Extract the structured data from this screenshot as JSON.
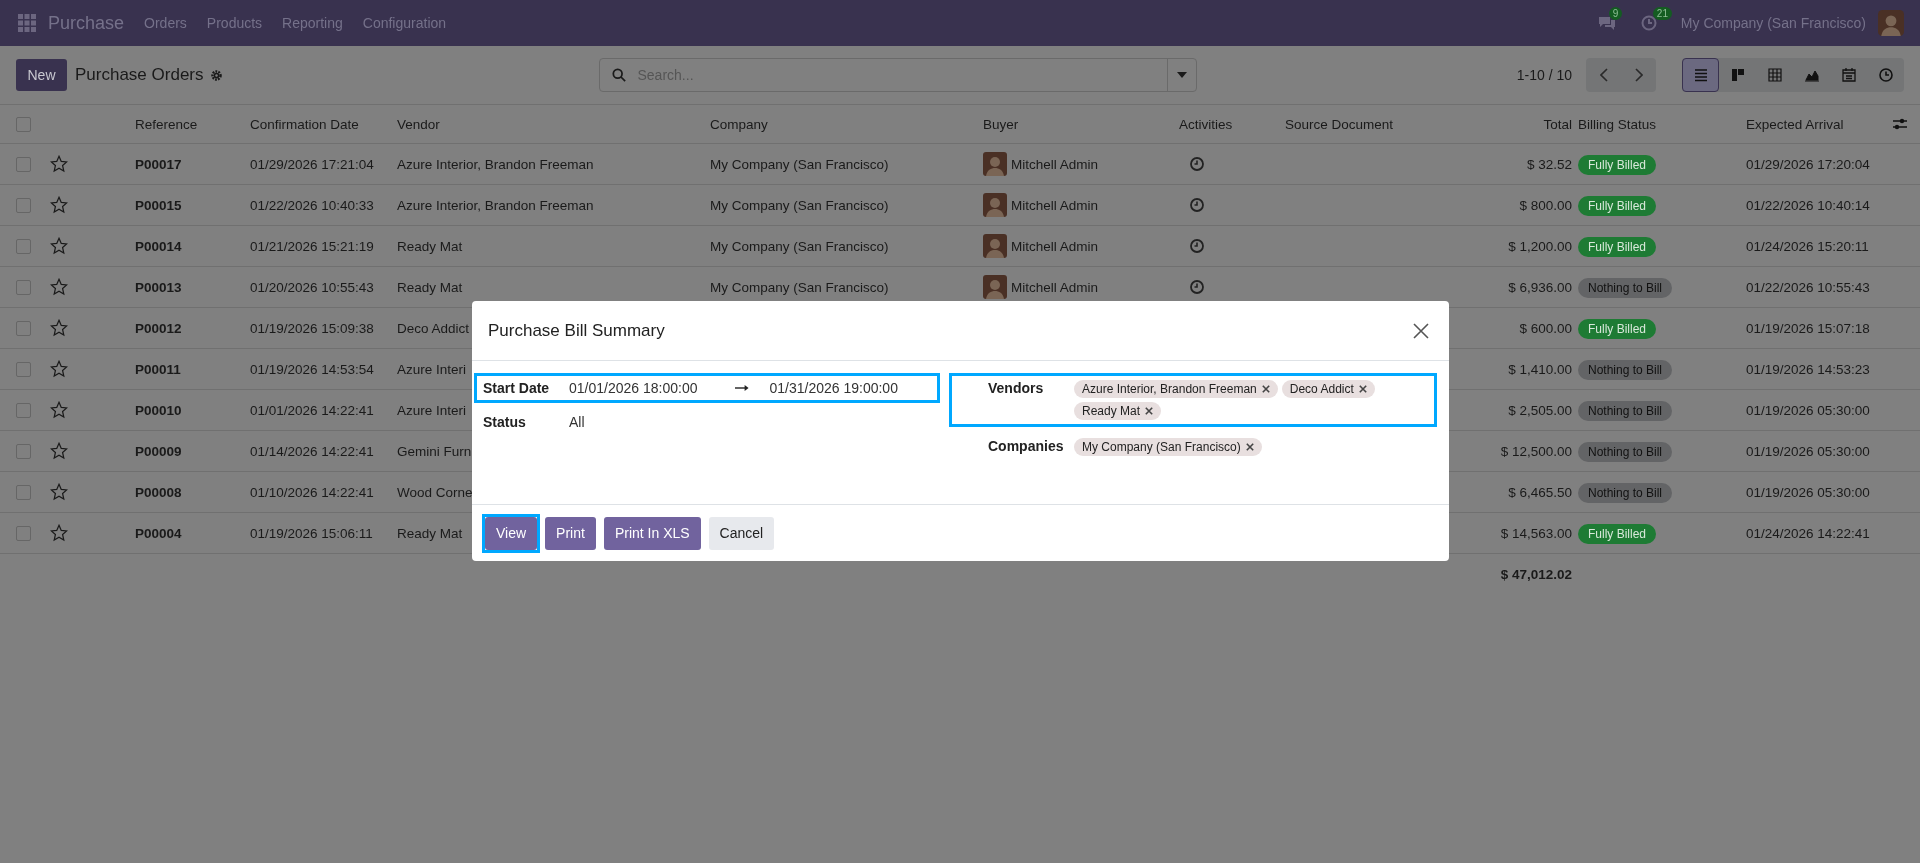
{
  "navbar": {
    "app_name": "Purchase",
    "menu": [
      "Orders",
      "Products",
      "Reporting",
      "Configuration"
    ],
    "messages_count": "9",
    "activities_count": "21",
    "company": "My Company (San Francisco)"
  },
  "control_panel": {
    "new_button": "New",
    "title": "Purchase Orders",
    "search": {
      "placeholder": "Search..."
    },
    "pager": "1-10 / 10",
    "views": [
      {
        "kind": "list",
        "selected": true
      },
      {
        "kind": "kanban",
        "selected": false
      },
      {
        "kind": "pivot",
        "selected": false
      },
      {
        "kind": "graph",
        "selected": false
      },
      {
        "kind": "calendar",
        "selected": false
      },
      {
        "kind": "activity",
        "selected": false
      }
    ]
  },
  "table": {
    "all_selected": false,
    "columns": [
      "Reference",
      "Confirmation Date",
      "Vendor",
      "Company",
      "Buyer",
      "Activities",
      "Source Document",
      "Total",
      "Billing Status",
      "Expected Arrival"
    ],
    "rows": [
      {
        "selected": false,
        "starred": false,
        "reference": "P00017",
        "confirmation_date": "01/29/2026 17:21:04",
        "vendor": "Azure Interior, Brandon Freeman",
        "company": "My Company (San Francisco)",
        "buyer": "Mitchell Admin",
        "has_activity": true,
        "total": "$ 32.52",
        "billing_status": {
          "label": "Fully Billed",
          "color": "#1e7b34"
        },
        "expected_arrival": "01/29/2026 17:20:04"
      },
      {
        "selected": false,
        "starred": false,
        "reference": "P00015",
        "confirmation_date": "01/22/2026 10:40:33",
        "vendor": "Azure Interior, Brandon Freeman",
        "company": "My Company (San Francisco)",
        "buyer": "Mitchell Admin",
        "has_activity": true,
        "total": "$ 800.00",
        "billing_status": {
          "label": "Fully Billed",
          "color": "#1e7b34"
        },
        "expected_arrival": "01/22/2026 10:40:14"
      },
      {
        "selected": false,
        "starred": false,
        "reference": "P00014",
        "confirmation_date": "01/21/2026 15:21:19",
        "vendor": "Ready Mat",
        "company": "My Company (San Francisco)",
        "buyer": "Mitchell Admin",
        "has_activity": true,
        "total": "$ 1,200.00",
        "billing_status": {
          "label": "Fully Billed",
          "color": "#1e7b34"
        },
        "expected_arrival": "01/24/2026 15:20:11"
      },
      {
        "selected": false,
        "starred": false,
        "reference": "P00013",
        "confirmation_date": "01/20/2026 10:55:43",
        "vendor": "Ready Mat",
        "company": "My Company (San Francisco)",
        "buyer": "Mitchell Admin",
        "has_activity": true,
        "total": "$ 6,936.00",
        "billing_status": {
          "label": "Nothing to Bill",
          "color": "#636466"
        },
        "expected_arrival": "01/22/2026 10:55:43"
      },
      {
        "selected": false,
        "starred": false,
        "reference": "P00012",
        "confirmation_date": "01/19/2026 15:09:38",
        "vendor": "Deco Addict",
        "total": "$ 600.00",
        "billing_status": {
          "label": "Fully Billed",
          "color": "#1e7b34"
        },
        "expected_arrival": "01/19/2026 15:07:18"
      },
      {
        "selected": false,
        "starred": false,
        "reference": "P00011",
        "confirmation_date": "01/19/2026 14:53:54",
        "vendor": "Azure Interi",
        "total": "$ 1,410.00",
        "billing_status": {
          "label": "Nothing to Bill",
          "color": "#636466"
        },
        "expected_arrival": "01/19/2026 14:53:23"
      },
      {
        "selected": false,
        "starred": false,
        "reference": "P00010",
        "confirmation_date": "01/01/2026 14:22:41",
        "vendor": "Azure Interi",
        "total": "$ 2,505.00",
        "billing_status": {
          "label": "Nothing to Bill",
          "color": "#636466"
        },
        "expected_arrival": "01/19/2026 05:30:00"
      },
      {
        "selected": false,
        "starred": false,
        "reference": "P00009",
        "confirmation_date": "01/14/2026 14:22:41",
        "vendor": "Gemini Furn",
        "total": "$ 12,500.00",
        "billing_status": {
          "label": "Nothing to Bill",
          "color": "#636466"
        },
        "expected_arrival": "01/19/2026 05:30:00"
      },
      {
        "selected": false,
        "starred": false,
        "reference": "P00008",
        "confirmation_date": "01/10/2026 14:22:41",
        "vendor": "Wood Corne",
        "total": "$ 6,465.50",
        "billing_status": {
          "label": "Nothing to Bill",
          "color": "#636466"
        },
        "expected_arrival": "01/19/2026 05:30:00"
      },
      {
        "selected": false,
        "starred": false,
        "reference": "P00004",
        "confirmation_date": "01/19/2026 15:06:11",
        "vendor": "Ready Mat",
        "total": "$ 14,563.00",
        "billing_status": {
          "label": "Fully Billed",
          "color": "#1e7b34"
        },
        "expected_arrival": "01/24/2026 14:22:41"
      }
    ],
    "sum_total": "$ 47,012.02"
  },
  "dialog": {
    "title": "Purchase Bill Summary",
    "start_date": {
      "label": "Start Date",
      "from": "01/01/2026 18:00:00",
      "to": "01/31/2026 19:00:00",
      "highlighted": true
    },
    "status": {
      "label": "Status",
      "value": "All"
    },
    "vendors": {
      "label": "Vendors",
      "tags": [
        "Azure Interior, Brandon Freeman",
        "Deco Addict",
        "Ready Mat"
      ],
      "highlighted": true
    },
    "companies": {
      "label": "Companies",
      "tags": [
        "My Company (San Francisco)"
      ],
      "highlighted": false
    },
    "buttons": [
      {
        "label": "View",
        "kind": "primary",
        "highlighted": true
      },
      {
        "label": "Print",
        "kind": "primary",
        "highlighted": false
      },
      {
        "label": "Print In XLS",
        "kind": "primary",
        "highlighted": false
      },
      {
        "label": "Cancel",
        "kind": "secondary",
        "highlighted": false
      }
    ]
  }
}
